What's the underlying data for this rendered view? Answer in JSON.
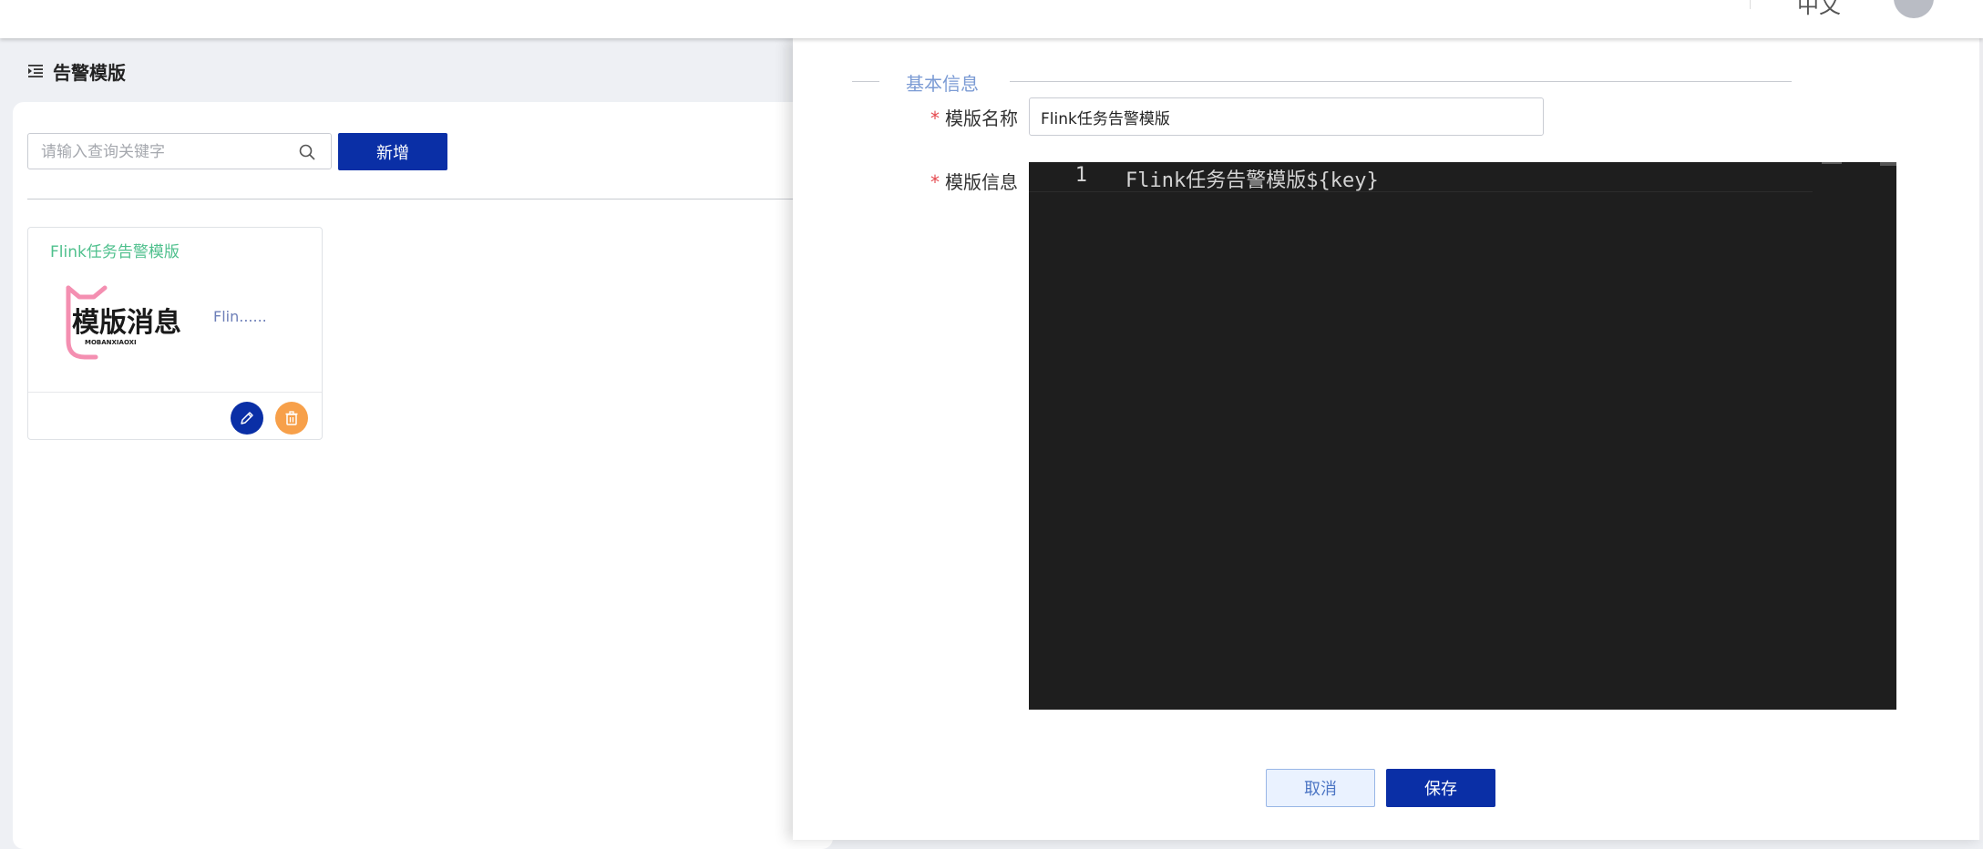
{
  "header": {
    "language_label": "中文"
  },
  "page": {
    "title": "告警模版"
  },
  "toolbar": {
    "search_placeholder": "请输入查询关键字",
    "search_value": "",
    "add_label": "新增"
  },
  "cards": [
    {
      "title": "Flink任务告警模版",
      "logo_text": "模版消息",
      "logo_subtext": "MOBANXIAOXI",
      "description": "Flin......"
    }
  ],
  "drawer": {
    "section_title": "基本信息",
    "fields": {
      "name_label": "模版名称",
      "name_value": "Flink任务告警模版",
      "info_label": "模版信息",
      "required_mark": "*"
    },
    "editor": {
      "lines": [
        {
          "number": "1",
          "text": "Flink任务告警模版${key}"
        }
      ]
    },
    "buttons": {
      "cancel_label": "取消",
      "save_label": "保存"
    }
  },
  "colors": {
    "primary": "#0a2fa6",
    "card_title": "#4fc08d",
    "delete": "#f7a04a",
    "required": "#e5484d",
    "editor_bg": "#1e1e1e"
  },
  "icons": {
    "menu": "indent-list-icon",
    "search": "search-icon",
    "edit": "pencil-icon",
    "delete": "trash-icon"
  }
}
